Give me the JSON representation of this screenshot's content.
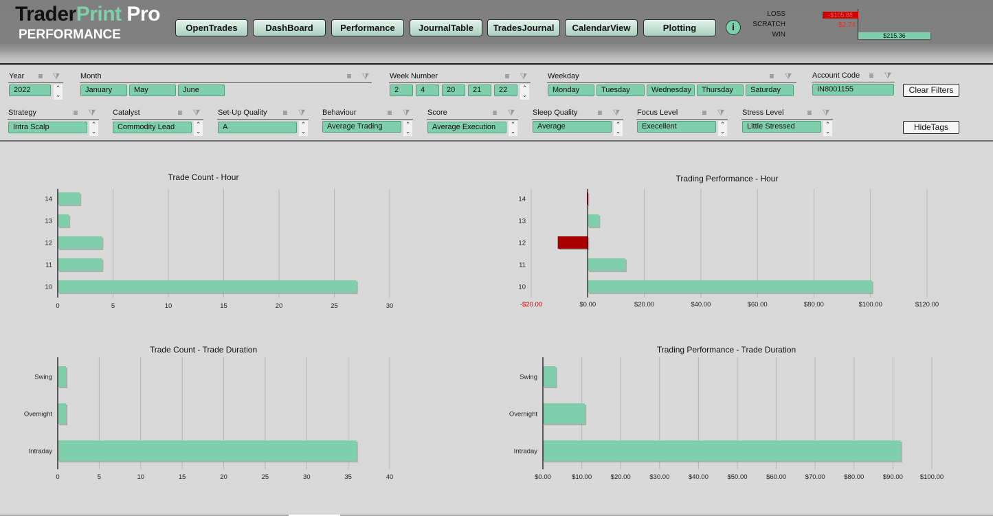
{
  "app": {
    "title_part1": "Trader",
    "title_part2": "Print",
    "title_part3": " Pro",
    "subtitle": "PERFORMANCE"
  },
  "nav": {
    "buttons": [
      {
        "label": "OpenTrades"
      },
      {
        "label": "DashBoard"
      },
      {
        "label": "Performance"
      },
      {
        "label": "JournalTable"
      },
      {
        "label": "TradesJournal"
      },
      {
        "label": "CalendarView"
      },
      {
        "label": "Plotting"
      }
    ],
    "info_icon": "i"
  },
  "summary": {
    "loss_label": "LOSS",
    "scratch_label": "SCRATCH",
    "win_label": "WIN",
    "loss_value": "-$105.88",
    "scratch_value": "-$2.74",
    "win_value": "$215.36",
    "loss_amount": -105.88,
    "scratch_amount": -2.74,
    "win_amount": 215.36,
    "loss_color": "#cc0000",
    "win_color": "#7fcfac"
  },
  "filters": {
    "year": {
      "label": "Year",
      "values": [
        "2022"
      ]
    },
    "month": {
      "label": "Month",
      "values": [
        "January",
        "May",
        "June"
      ]
    },
    "week_number": {
      "label": "Week Number",
      "values": [
        "2",
        "4",
        "20",
        "21",
        "22"
      ]
    },
    "weekday": {
      "label": "Weekday",
      "values": [
        "Monday",
        "Tuesday",
        "Wednesday",
        "Thursday",
        "Saturday"
      ]
    },
    "account_code": {
      "label": "Account Code",
      "values": [
        "IN8001155"
      ]
    },
    "strategy": {
      "label": "Strategy",
      "values": [
        "Intra Scalp"
      ]
    },
    "catalyst": {
      "label": "Catalyst",
      "values": [
        "Commodity Lead"
      ]
    },
    "setup_quality": {
      "label": "Set-Up Quality",
      "values": [
        "A"
      ]
    },
    "behaviour": {
      "label": "Behaviour",
      "values": [
        "Average Trading"
      ]
    },
    "score": {
      "label": "Score",
      "values": [
        "Average Execution"
      ]
    },
    "sleep_quality": {
      "label": "Sleep Quality",
      "values": [
        "Average"
      ]
    },
    "focus_level": {
      "label": "Focus Level",
      "values": [
        "Execellent"
      ]
    },
    "stress_level": {
      "label": "Stress Level",
      "values": [
        "Little Stressed"
      ]
    },
    "clear_filters_label": "Clear Filters",
    "hide_tags_label": "HideTags",
    "multiselect_icon": "≡",
    "clear_filter_icon": "⧩"
  },
  "colors": {
    "positive": "#7fcfac",
    "negative": "#a80000",
    "negative_tick": "#cc0000"
  },
  "chart_data": [
    {
      "id": "count-hour",
      "type": "bar",
      "orientation": "horizontal",
      "title": "Trade Count - Hour",
      "categories": [
        "10",
        "11",
        "12",
        "13",
        "14"
      ],
      "values": [
        27,
        4,
        4,
        1,
        2
      ],
      "xlim": [
        0,
        30
      ],
      "xticks": [
        0,
        5,
        10,
        15,
        20,
        25,
        30
      ],
      "xtick_labels": [
        "0",
        "5",
        "10",
        "15",
        "20",
        "25",
        "30"
      ],
      "grid": true
    },
    {
      "id": "perf-hour",
      "type": "bar",
      "orientation": "horizontal",
      "title": "Trading Performance - Hour",
      "categories": [
        "10",
        "11",
        "12",
        "13",
        "14"
      ],
      "values": [
        100.5,
        13.3,
        -10.6,
        3.9,
        -0.3
      ],
      "xlim": [
        -20,
        120
      ],
      "xticks": [
        -20,
        0,
        20,
        40,
        60,
        80,
        100,
        120
      ],
      "xtick_labels": [
        "-$20.00",
        "$0.00",
        "$20.00",
        "$40.00",
        "$60.00",
        "$80.00",
        "$100.00",
        "$120.00"
      ],
      "grid": true
    },
    {
      "id": "count-duration",
      "type": "bar",
      "orientation": "horizontal",
      "title": "Trade Count -  Trade Duration",
      "categories": [
        "Intraday",
        "Overnight",
        "Swing"
      ],
      "values": [
        36,
        1,
        1
      ],
      "xlim": [
        0,
        40
      ],
      "xticks": [
        0,
        5,
        10,
        15,
        20,
        25,
        30,
        35,
        40
      ],
      "xtick_labels": [
        "0",
        "5",
        "10",
        "15",
        "20",
        "25",
        "30",
        "35",
        "40"
      ],
      "grid": true
    },
    {
      "id": "perf-duration",
      "type": "bar",
      "orientation": "horizontal",
      "title": "Trading Performance - Trade Duration",
      "categories": [
        "Intraday",
        "Overnight",
        "Swing"
      ],
      "values": [
        92.0,
        10.8,
        3.3
      ],
      "xlim": [
        0,
        100
      ],
      "xticks": [
        0,
        10,
        20,
        30,
        40,
        50,
        60,
        70,
        80,
        90,
        100
      ],
      "xtick_labels": [
        "$0.00",
        "$10.00",
        "$20.00",
        "$30.00",
        "$40.00",
        "$50.00",
        "$60.00",
        "$70.00",
        "$80.00",
        "$90.00",
        "$100.00"
      ],
      "grid": true
    }
  ]
}
